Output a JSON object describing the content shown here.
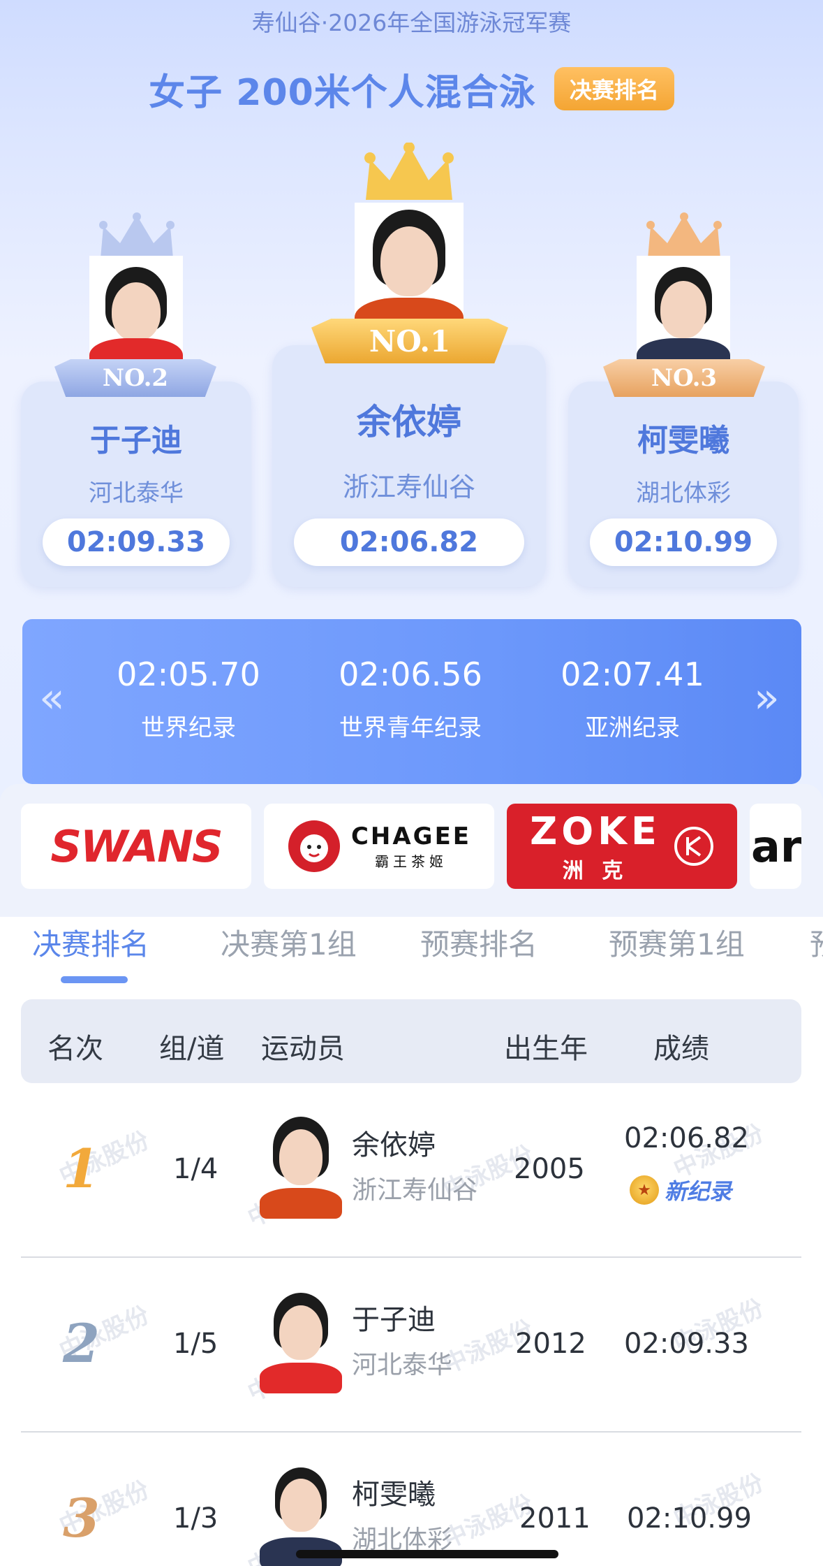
{
  "header": {
    "event_name": "寿仙谷·2026年全国游泳冠军赛",
    "title": "女子 200米个人混合泳",
    "tag": "决赛排名"
  },
  "podium": [
    {
      "rank_label": "NO.2",
      "name": "于子迪",
      "team": "河北泰华",
      "time": "02:09.33",
      "ribbon_color": "#9fb4ea"
    },
    {
      "rank_label": "NO.1",
      "name": "余依婷",
      "team": "浙江寿仙谷",
      "time": "02:06.82",
      "ribbon_color": "#f2b94a"
    },
    {
      "rank_label": "NO.3",
      "name": "柯雯曦",
      "team": "湖北体彩",
      "time": "02:10.99",
      "ribbon_color": "#f0b98a"
    }
  ],
  "records": [
    {
      "time": "02:05.70",
      "label": "世界纪录"
    },
    {
      "time": "02:06.56",
      "label": "世界青年纪录"
    },
    {
      "time": "02:07.41",
      "label": "亚洲纪录"
    }
  ],
  "records_nav": {
    "prev_icon": "«",
    "next_icon": "»"
  },
  "sponsors": [
    {
      "name": "SWANS",
      "brand_color": "#e0262d"
    },
    {
      "name": "CHAGEE",
      "sub": "霸王茶姬",
      "brand_color": "#d4202a"
    },
    {
      "name": "ZOKE",
      "sub": "洲 克",
      "brand_color": "#d9202a"
    },
    {
      "name": "ar",
      "brand_color": "#111111"
    }
  ],
  "tabs": [
    "决赛排名",
    "决赛第1组",
    "预赛排名",
    "预赛第1组",
    "预"
  ],
  "table": {
    "headers": {
      "rank": "名次",
      "lane": "组/道",
      "athlete": "运动员",
      "birth": "出生年",
      "result": "成绩"
    },
    "rows": [
      {
        "rank": "1",
        "lane": "1/4",
        "name": "余依婷",
        "team": "浙江寿仙谷",
        "birth": "2005",
        "result": "02:06.82",
        "badge": "新纪录",
        "rank_color": "#f2a93b"
      },
      {
        "rank": "2",
        "lane": "1/5",
        "name": "于子迪",
        "team": "河北泰华",
        "birth": "2012",
        "result": "02:09.33",
        "badge": "",
        "rank_color": "#8ea3bf"
      },
      {
        "rank": "3",
        "lane": "1/3",
        "name": "柯雯曦",
        "team": "湖北体彩",
        "birth": "2011",
        "result": "02:10.99",
        "badge": "",
        "rank_color": "#d9a06a"
      }
    ],
    "watermark": "中泳股份"
  },
  "colors": {
    "accent": "#5c86ea",
    "tag": "#f4a533",
    "records_bg": "#6c98fb"
  }
}
